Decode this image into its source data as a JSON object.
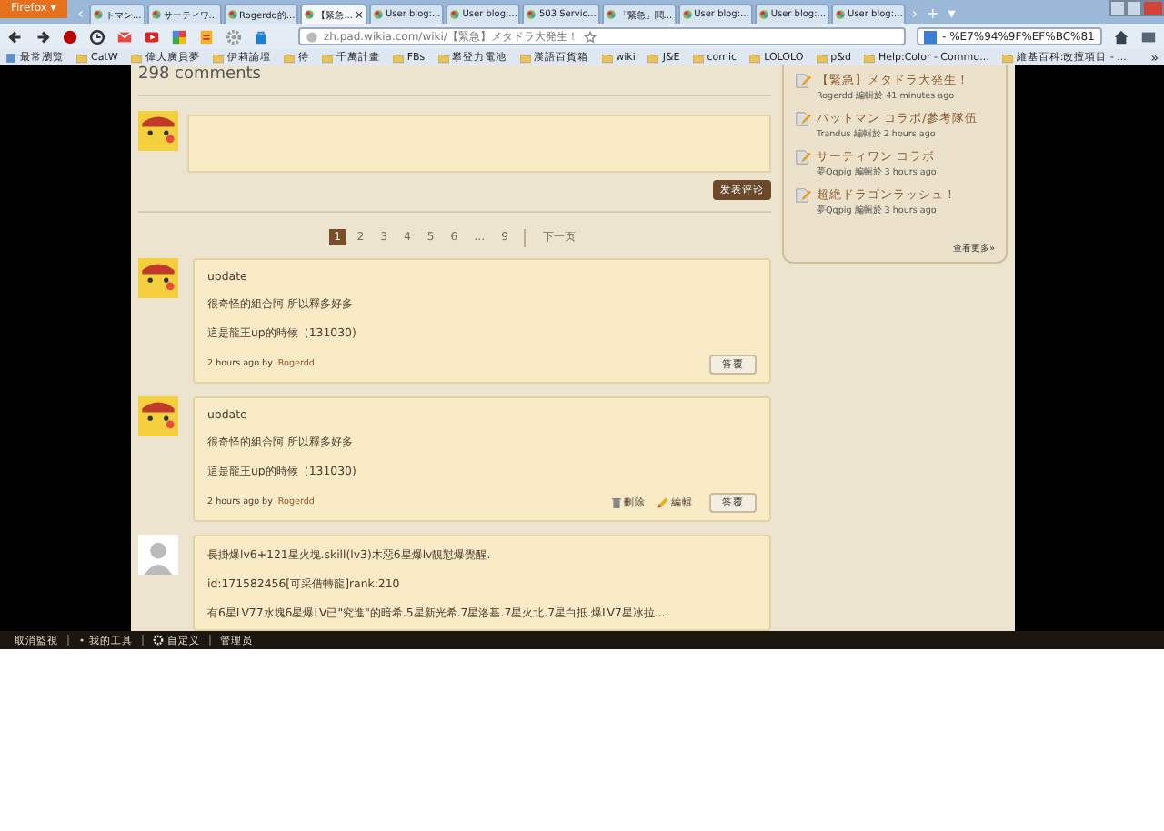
{
  "browser": {
    "app_menu": "Firefox ▾",
    "tabs": [
      {
        "label": "トマン...",
        "selected": false
      },
      {
        "label": "サーティワ...",
        "selected": false
      },
      {
        "label": "Rogerdd的...",
        "selected": false
      },
      {
        "label": "【緊急...",
        "selected": true
      },
      {
        "label": "User blog:...",
        "selected": false
      },
      {
        "label": "User blog:...",
        "selected": false
      },
      {
        "label": "503 Servic...",
        "selected": false
      },
      {
        "label": "「緊急」鬨...",
        "selected": false
      },
      {
        "label": "User blog:...",
        "selected": false
      },
      {
        "label": "User blog:...",
        "selected": false
      },
      {
        "label": "User blog:...",
        "selected": false
      }
    ],
    "tab_close": "×",
    "tab_scroll_left": "‹",
    "tab_scroll": "›",
    "new_tab": "+",
    "tab_list": "▾",
    "address": "zh.pad.wikia.com/wiki/【緊急】メタドラ大発生！",
    "search": "- %E7%94%9F%EF%BC%81",
    "bookmarks": [
      "最常瀏覽",
      "CatW",
      "偉大廣員夢",
      "伊莉論壇",
      "待",
      "千萬計畫",
      "FBs",
      "攀登力電池",
      "漢語百貨箱",
      "wiki",
      "J&E",
      "comic",
      "LOLOLO",
      "p&d",
      "Help:Color - Commu...",
      "維基百科:改擅項目 - ..."
    ],
    "bookmarks_more": "»"
  },
  "page": {
    "comments_heading": "298 comments",
    "post_button": "发表评论",
    "pagination": [
      {
        "label": "1",
        "selected": true
      },
      {
        "label": "2",
        "selected": false
      },
      {
        "label": "3",
        "selected": false
      },
      {
        "label": "4",
        "selected": false
      },
      {
        "label": "5",
        "selected": false
      },
      {
        "label": "6",
        "selected": false
      },
      {
        "label": "…",
        "selected": false
      },
      {
        "label": "9",
        "selected": false
      }
    ],
    "next_page": "下一页",
    "comments": [
      {
        "kind": "character",
        "title": "update",
        "lines": [
          "很奇怪的組合阿 所以釋多好多",
          "這是龍王up的時候（131030)"
        ],
        "time": "2 hours ago by",
        "author": "Rogerdd",
        "reply": "答覆"
      },
      {
        "kind": "character",
        "title": "update",
        "lines": [
          "很奇怪的組合阿 所以釋多好多",
          "這是龍王up的時候（131030)"
        ],
        "time": "2 hours ago by",
        "author": "Rogerdd",
        "reply": "答覆",
        "actions": [
          {
            "kind": "delete",
            "label": "刪除"
          },
          {
            "kind": "edit",
            "label": "編輯"
          }
        ]
      },
      {
        "kind": "default",
        "lines": [
          "長掛爆lv6+121星火塊.skill(lv3)木惡6星爆lv靚懟爆覺醒.",
          "id:171582456[可采借轉龍]rank:210",
          "有6星LV77水塊6星爆LV已\"究進\"的暗希.5星新光希.7星洛基.7星火北.7星白抵.爆LV7星冰拉...."
        ]
      }
    ]
  },
  "sidebar": {
    "items": [
      {
        "title": "【緊急】メタドラ大発生！",
        "author": "Rogerdd",
        "meta": "編輯於 41 minutes ago"
      },
      {
        "title": "バットマン コラボ/參考隊伍",
        "author": "Trandus",
        "meta": "編輯於 2 hours ago"
      },
      {
        "title": "サーティワン コラボ",
        "author": "夢Qqpig",
        "meta": "編輯於 3 hours ago"
      },
      {
        "title": "超絶ドラゴンラッシュ！",
        "author": "夢Qqpig",
        "meta": "編輯於 3 hours ago"
      }
    ],
    "see_more": "查看更多»"
  },
  "toolbar": [
    "取消監視",
    "我的工具",
    "自定义",
    "管理员"
  ]
}
